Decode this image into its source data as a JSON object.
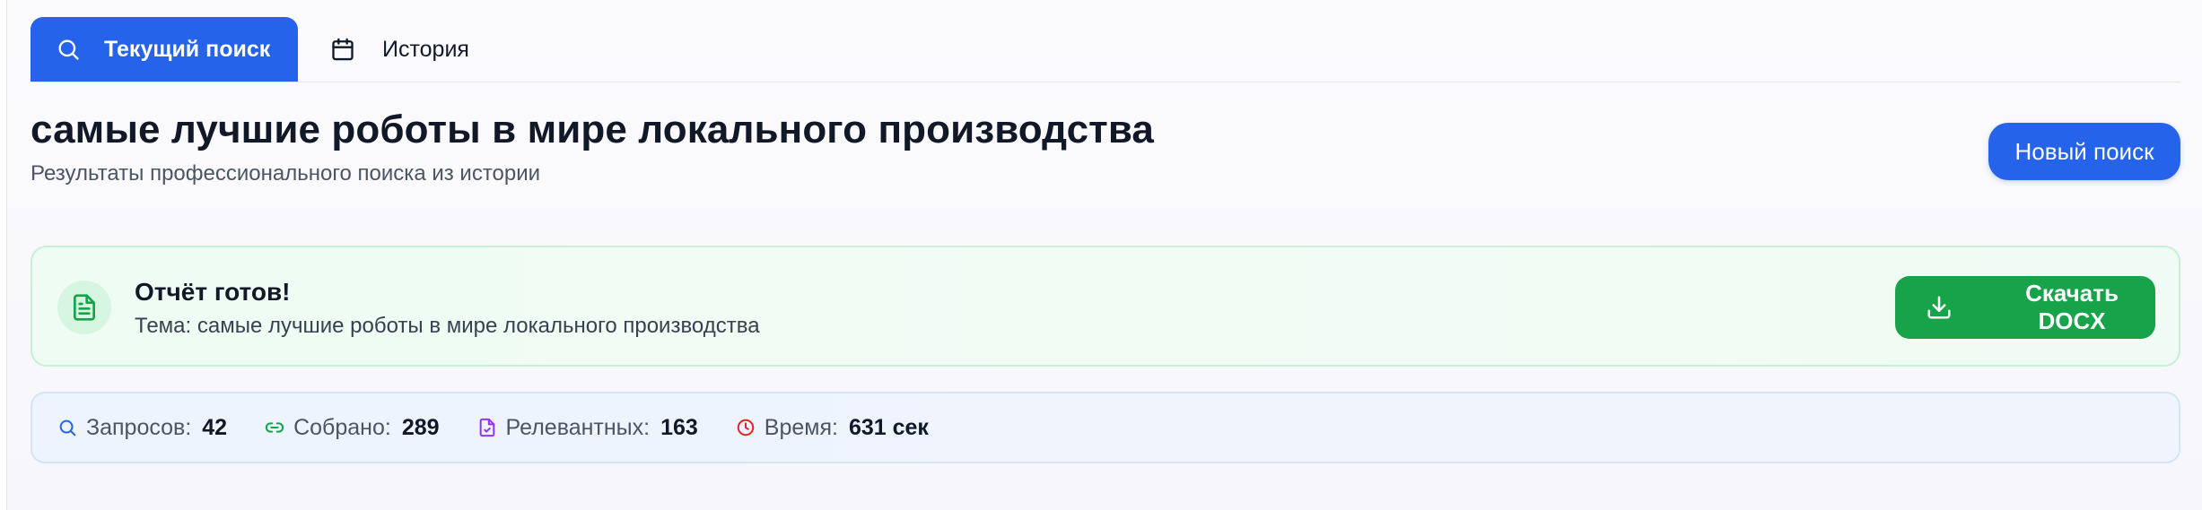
{
  "tabs": [
    {
      "label": "Текущий поиск",
      "icon": "search-icon",
      "active": true
    },
    {
      "label": "История",
      "icon": "calendar-icon",
      "active": false
    }
  ],
  "header": {
    "title": "самые лучшие роботы в мире локального производства",
    "subtitle": "Результаты профессионального поиска из истории",
    "new_search_label": "Новый поиск"
  },
  "report": {
    "title": "Отчёт готов!",
    "topic": "Тема: самые лучшие роботы в мире локального производства",
    "download_label": "Скачать DOCX",
    "icon": "document-icon"
  },
  "stats": [
    {
      "label": "Запросов:",
      "value": "42",
      "icon": "search-icon",
      "color": "#2563eb"
    },
    {
      "label": "Собрано:",
      "value": "289",
      "icon": "link-icon",
      "color": "#16a34a"
    },
    {
      "label": "Релевантных:",
      "value": "163",
      "icon": "file-check-icon",
      "color": "#9333ea"
    },
    {
      "label": "Время:",
      "value": "631 сек",
      "icon": "clock-icon",
      "color": "#dc2626"
    }
  ],
  "colors": {
    "primary": "#2563eb",
    "success": "#16a34a",
    "success_bg": "#eefcf3",
    "stats_bg": "#eef4fe"
  }
}
